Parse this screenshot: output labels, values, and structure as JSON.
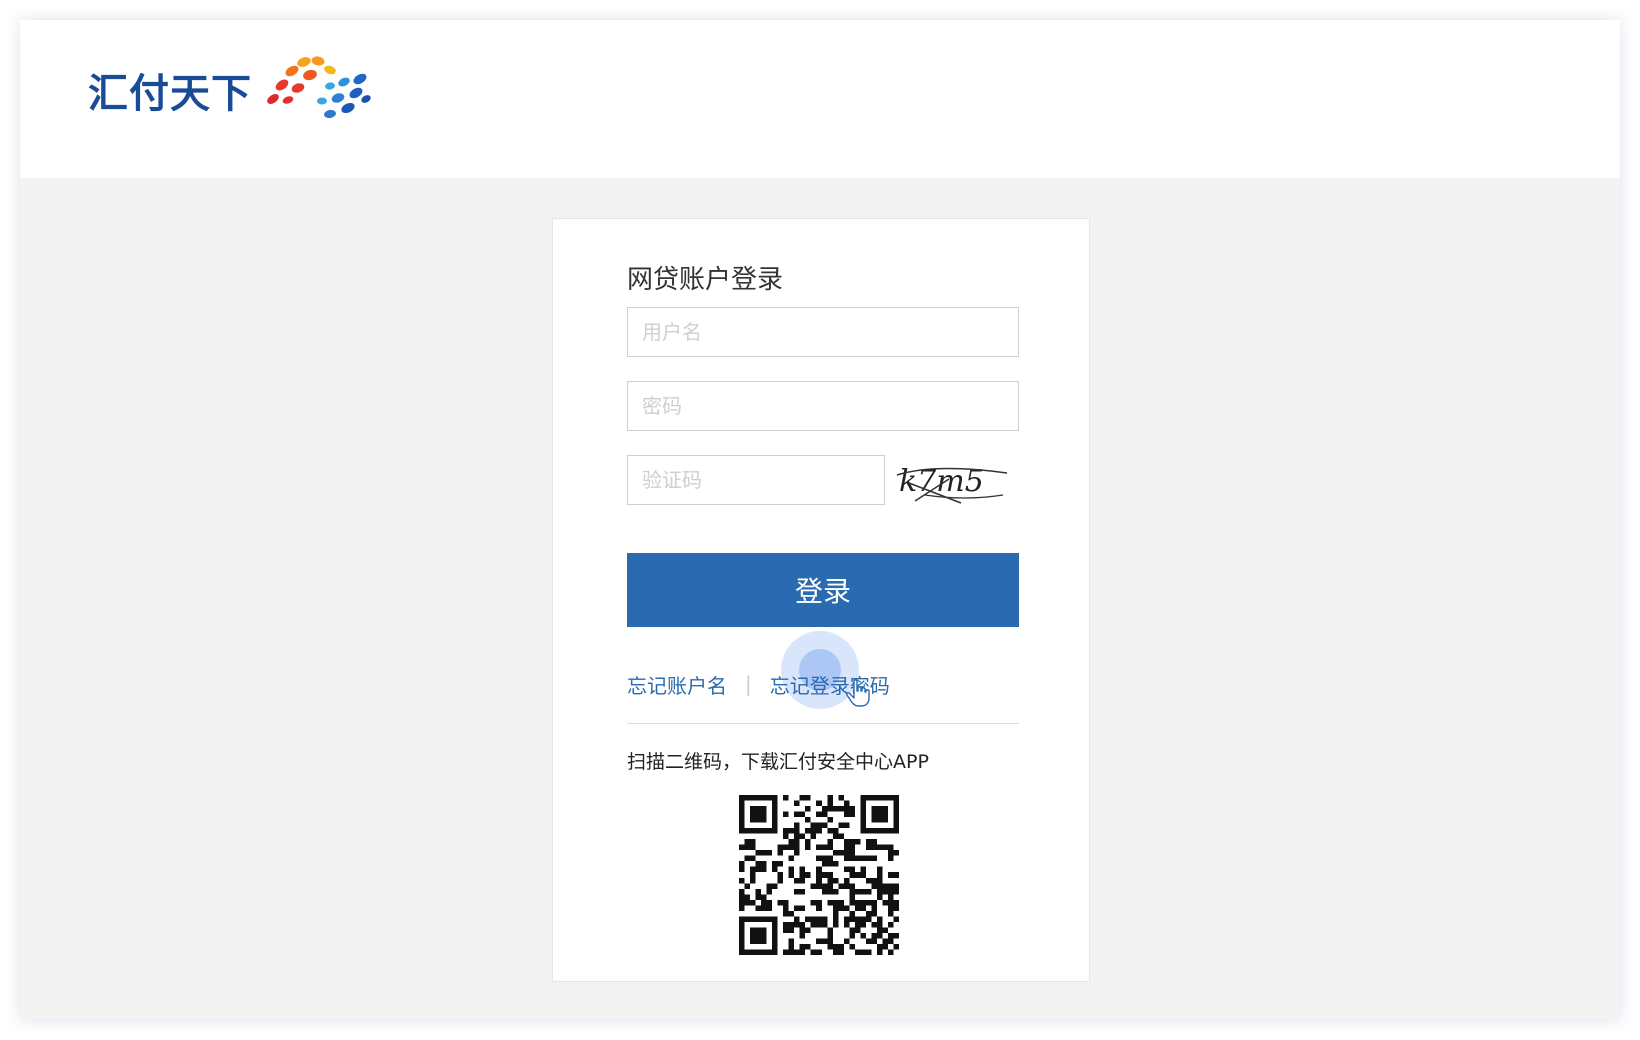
{
  "brand": {
    "name": "汇付天下",
    "logo_icon": "colorful-dot-flower-logo"
  },
  "login": {
    "title": "网贷账户登录",
    "username_placeholder": "用户名",
    "password_placeholder": "密码",
    "captcha_placeholder": "验证码",
    "captcha_text": "k7m5",
    "submit_label": "登录",
    "forgot_account": "忘记账户名",
    "separator": "|",
    "forgot_password": "忘记登录密码"
  },
  "download": {
    "caption": "扫描二维码，下载汇付安全中心APP",
    "qr_icon": "qr-code"
  },
  "colors": {
    "brand_blue": "#1a4b96",
    "button_blue": "#2a6ab0",
    "link_blue": "#2a6ab0",
    "page_bg": "#f3f3f3"
  }
}
